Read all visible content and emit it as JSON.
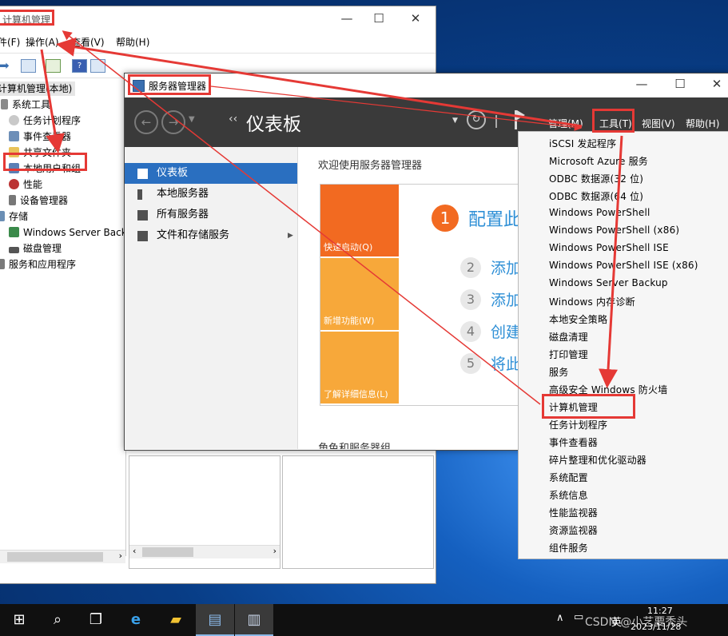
{
  "computer_management": {
    "title": "计算机管理",
    "menu": [
      "文件(F)",
      "操作(A)",
      "查看(V)",
      "帮助(H)"
    ],
    "tree": [
      "计算机管理(本地)",
      "系统工具",
      "任务计划程序",
      "事件查看器",
      "共享文件夹",
      "本地用户和组",
      "性能",
      "设备管理器",
      "存储",
      "Windows Server Back",
      "磁盘管理",
      "服务和应用程序"
    ]
  },
  "server_manager": {
    "title": "服务器管理器",
    "header_title": "仪表板",
    "header_menu": {
      "manage": "管理(M)",
      "tools": "工具(T)",
      "view": "视图(V)",
      "help": "帮助(H)"
    },
    "nav": [
      "仪表板",
      "本地服务器",
      "所有服务器",
      "文件和存储服务"
    ],
    "welcome": "欢迎使用服务器管理器",
    "tiles": [
      "快速启动(Q)",
      "新增功能(W)",
      "了解详细信息(L)"
    ],
    "steps": [
      {
        "num": "1",
        "text": "配置此"
      },
      {
        "num": "2",
        "text": "添加"
      },
      {
        "num": "3",
        "text": "添加"
      },
      {
        "num": "4",
        "text": "创建"
      },
      {
        "num": "5",
        "text": "将此"
      }
    ],
    "roles_heading": "角色和服务器组"
  },
  "tools_menu": [
    "iSCSI 发起程序",
    "Microsoft Azure 服务",
    "ODBC 数据源(32 位)",
    "ODBC 数据源(64 位)",
    "Windows PowerShell",
    "Windows PowerShell (x86)",
    "Windows PowerShell ISE",
    "Windows PowerShell ISE (x86)",
    "Windows Server Backup",
    "Windows 内存诊断",
    "本地安全策略",
    "磁盘清理",
    "打印管理",
    "服务",
    "高级安全 Windows 防火墙",
    "计算机管理",
    "任务计划程序",
    "事件查看器",
    "碎片整理和优化驱动器",
    "系统配置",
    "系统信息",
    "性能监视器",
    "资源监视器",
    "组件服务"
  ],
  "taskbar": {
    "time": "11:27",
    "date": "2023/11/28",
    "ime": "英",
    "watermark": "CSDN @小艺要秃头"
  },
  "colors": {
    "accent_orange": "#f26a21",
    "tile_light": "#f7a83a",
    "highlight_red": "#e53935",
    "link_blue": "#2e8fd6"
  }
}
